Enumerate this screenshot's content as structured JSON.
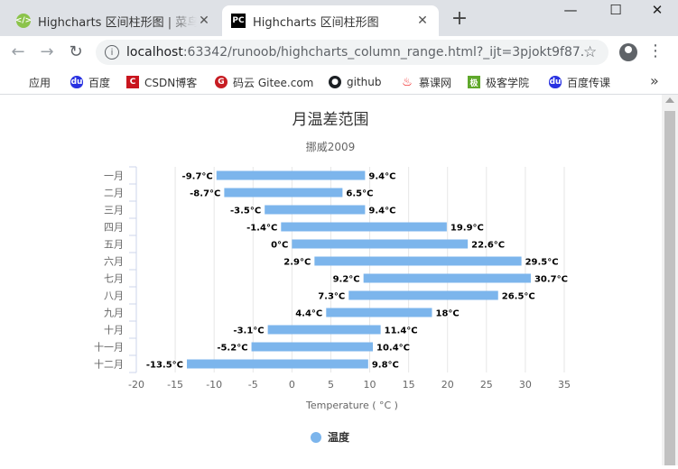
{
  "browser": {
    "tabs": [
      {
        "title": "Highcharts 区间柱形图 | 菜鸟教程",
        "icon": "runoob-favicon",
        "active": false
      },
      {
        "title": "Highcharts 区间柱形图",
        "icon": "pycharm-favicon",
        "active": true
      }
    ],
    "new_tab": "+",
    "window_controls": {
      "minimize": "—",
      "maximize": "☐",
      "close": "✕"
    },
    "url_host": "localhost",
    "url_rest": ":63342/runoob/highcharts_column_range.html?_ijt=3pjokt9f87...",
    "bookmarks": [
      {
        "label": "应用",
        "icon": "apps-icon",
        "color": "#4285f4"
      },
      {
        "label": "百度",
        "icon": "baidu-paw-icon",
        "color": "#2932e1"
      },
      {
        "label": "CSDN博客",
        "icon": "csdn-icon",
        "color": "#c9151e"
      },
      {
        "label": "码云 Gitee.com",
        "icon": "gitee-icon",
        "color": "#c71d23"
      },
      {
        "label": "github",
        "icon": "github-icon",
        "color": "#1b1f23"
      },
      {
        "label": "慕课网",
        "icon": "mooc-flame-icon",
        "color": "#f01414"
      },
      {
        "label": "极客学院",
        "icon": "jikexueyuan-icon",
        "color": "#5fa82b"
      },
      {
        "label": "百度传课",
        "icon": "baidu-paw-icon",
        "color": "#2932e1"
      }
    ],
    "bookmarks_more": "»"
  },
  "chart_data": {
    "type": "bar",
    "title": "月温差范围",
    "subtitle": "挪威2009",
    "categories": [
      "一月",
      "二月",
      "三月",
      "四月",
      "五月",
      "六月",
      "七月",
      "八月",
      "九月",
      "十月",
      "十一月",
      "十二月"
    ],
    "series": [
      {
        "name": "温度",
        "color": "#7cb5ec",
        "ranges": [
          [
            -9.7,
            9.4
          ],
          [
            -8.7,
            6.5
          ],
          [
            -3.5,
            9.4
          ],
          [
            -1.4,
            19.9
          ],
          [
            0.0,
            22.6
          ],
          [
            2.9,
            29.5
          ],
          [
            9.2,
            30.7
          ],
          [
            7.3,
            26.5
          ],
          [
            4.4,
            18.0
          ],
          [
            -3.1,
            11.4
          ],
          [
            -5.2,
            10.4
          ],
          [
            -13.5,
            9.8
          ]
        ],
        "low_labels": [
          "-9.7°C",
          "-8.7°C",
          "-3.5°C",
          "-1.4°C",
          "0°C",
          "2.9°C",
          "9.2°C",
          "7.3°C",
          "4.4°C",
          "-3.1°C",
          "-5.2°C",
          "-13.5°C"
        ],
        "high_labels": [
          "9.4°C",
          "6.5°C",
          "9.4°C",
          "19.9°C",
          "22.6°C",
          "29.5°C",
          "30.7°C",
          "26.5°C",
          "18°C",
          "11.4°C",
          "10.4°C",
          "9.8°C"
        ]
      }
    ],
    "xlabel": "Temperature ( °C )",
    "xlim": [
      -20,
      35
    ],
    "xticks": [
      -20,
      -15,
      -10,
      -5,
      0,
      5,
      10,
      15,
      20,
      25,
      30,
      35
    ],
    "xtick_labels": [
      "-20",
      "-15",
      "-10",
      "-5",
      "0",
      "5",
      "10",
      "15",
      "20",
      "25",
      "30",
      "35"
    ],
    "grid": true,
    "legend": "bottom-center"
  }
}
